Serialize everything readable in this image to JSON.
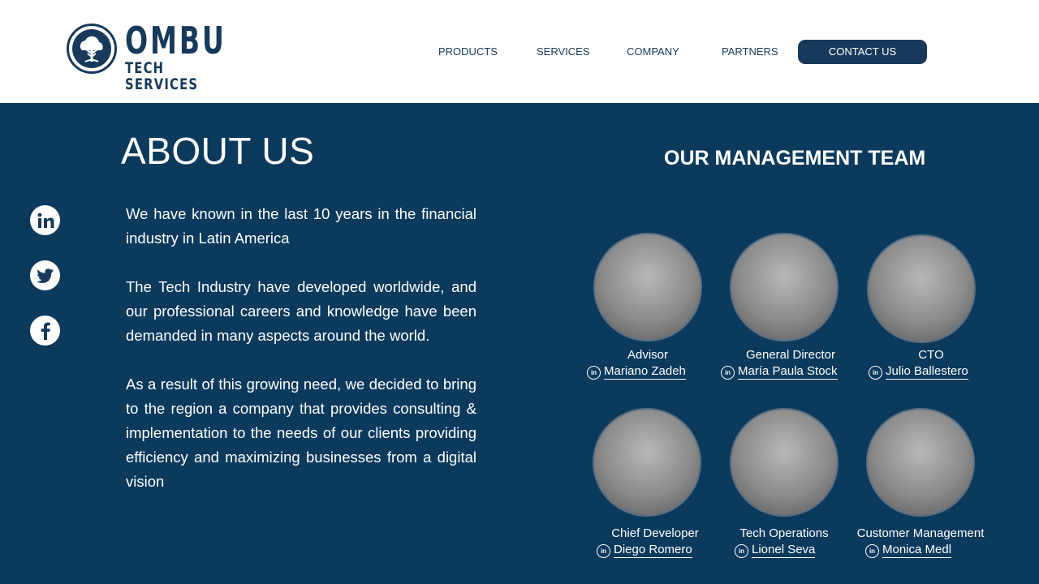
{
  "brand": {
    "name": "OMBU",
    "tagline": "TECH SERVICES"
  },
  "nav": {
    "products": "PRODUCTS",
    "services": "SERVICES",
    "company": "COMPANY",
    "partners": "PARTNERS",
    "contact": "CONTACT US"
  },
  "social": {
    "icons": [
      "linkedin-icon",
      "twitter-icon",
      "facebook-icon"
    ]
  },
  "about": {
    "title": "ABOUT US",
    "paragraphs": [
      "We have known in the last 10 years in the financial industry in Latin America",
      "The Tech Industry have developed worldwide, and our professional careers and knowledge have been demanded in many aspects around the world.",
      "As a result of this growing need, we decided to bring to the region a company that provides consulting & implementation to the needs of our clients providing efficiency and maximizing businesses from a digital vision"
    ]
  },
  "team": {
    "title": "OUR MANAGEMENT TEAM",
    "members": [
      {
        "role": "Advisor",
        "name": "Mariano Zadeh"
      },
      {
        "role": "General Director",
        "name": "María Paula Stock"
      },
      {
        "role": "CTO",
        "name": "Julio Ballestero"
      },
      {
        "role": "Chief Developer",
        "name": "Diego Romero"
      },
      {
        "role": "Tech Operations",
        "name": "Lionel Seva"
      },
      {
        "role": "Customer Management",
        "name": "Monica Medl"
      }
    ]
  },
  "colors": {
    "primary": "#173a5c",
    "background": "#0b3a5d",
    "text_light": "#ffffff"
  }
}
